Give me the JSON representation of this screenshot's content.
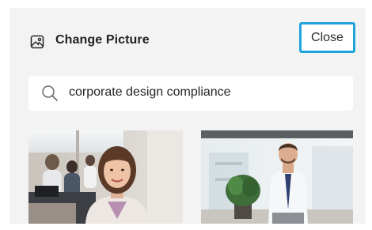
{
  "dialog": {
    "title": "Change Picture",
    "close_label": "Close"
  },
  "search": {
    "query": "corporate design compliance"
  },
  "results": [
    {
      "name": "woman-office-photo"
    },
    {
      "name": "man-office-photo"
    }
  ],
  "colors": {
    "panel_bg": "#f3f3f4",
    "focus_ring": "#1fa3dc"
  },
  "icons": {
    "title_icon": "picture-icon",
    "search_icon": "search-icon"
  }
}
